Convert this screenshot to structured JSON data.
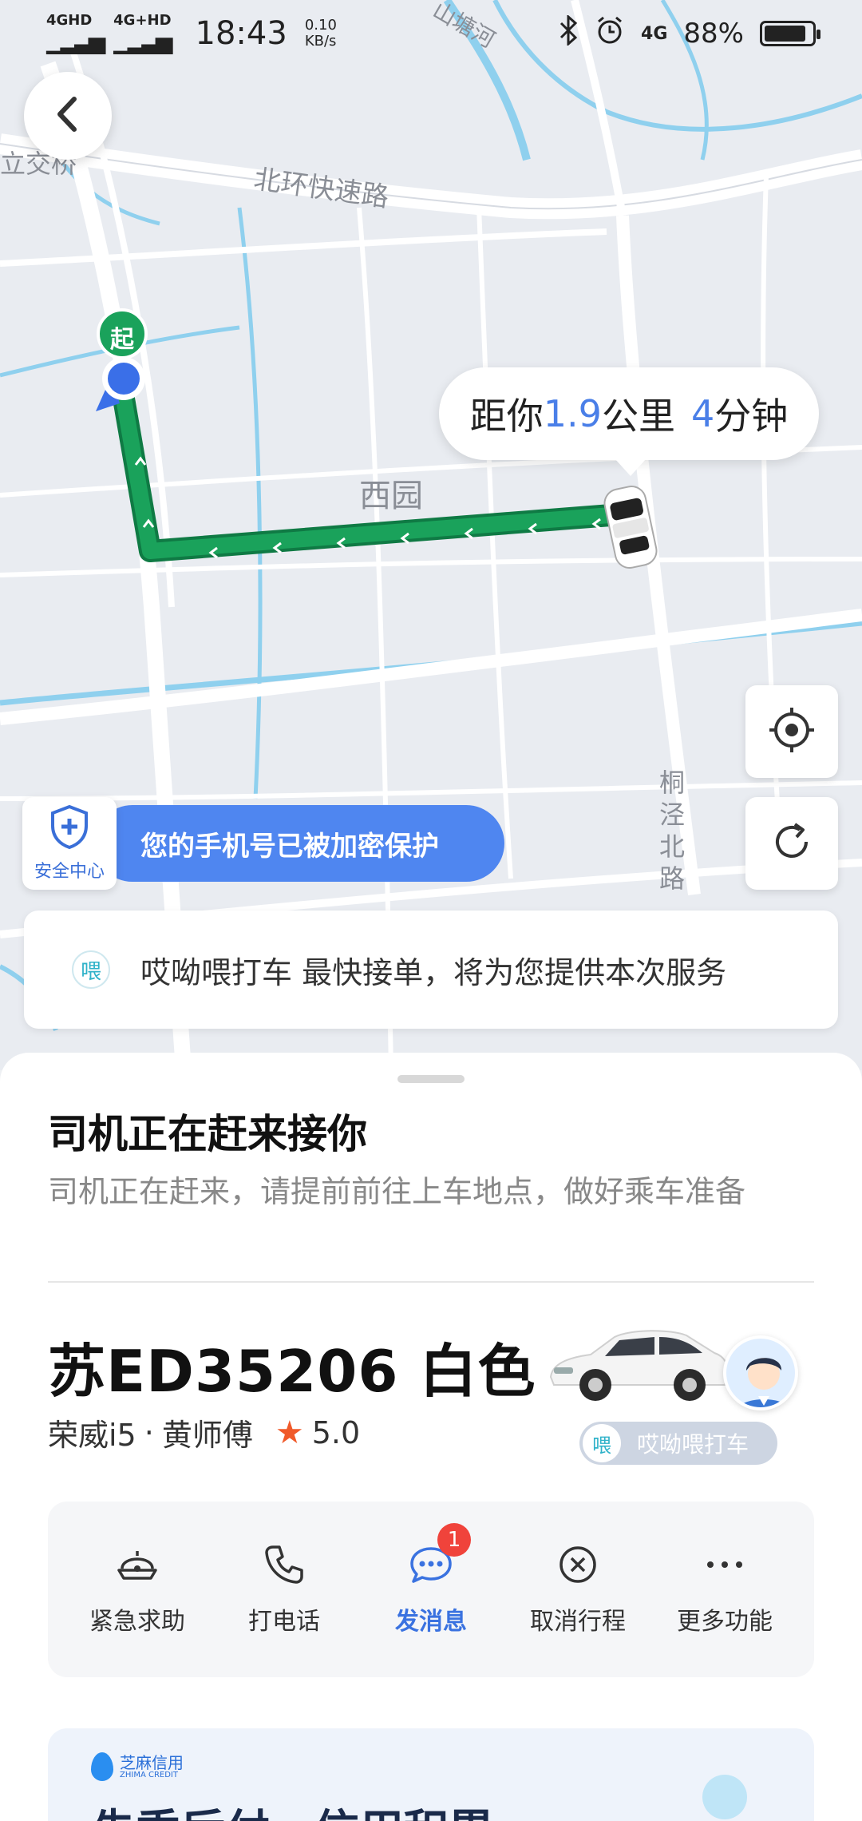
{
  "status_bar": {
    "sig1": "4GHD",
    "sig2": "4G+HD",
    "time": "18:43",
    "speed_top": "0.10",
    "speed_bottom": "KB/s",
    "net": "4G",
    "battery": "88%",
    "battery_level": 0.88
  },
  "map": {
    "road_label": "北环快速路",
    "area_label": "西园",
    "top_label": "立交桥",
    "canal_label": "山塘河",
    "road2_label": "桐泾北路",
    "start_marker": "起",
    "eta": {
      "prefix": "距你",
      "distance": "1.9",
      "distance_unit": "公里",
      "minutes": "4",
      "minutes_unit": "分钟"
    }
  },
  "safety": {
    "center_label": "安全中心",
    "privacy_text": "您的手机号已被加密保护"
  },
  "service": {
    "logo_char": "喂",
    "text": "哎呦喂打车 最快接单，将为您提供本次服务"
  },
  "sheet": {
    "title": "司机正在赶来接你",
    "subtitle": "司机正在赶来，请提前前往上车地点，做好乘车准备",
    "plate": "苏ED35206 白色",
    "car_model": "荣威i5",
    "dot": "·",
    "driver": "黄师傅",
    "rating": "5.0",
    "brand_tag": "哎呦喂打车",
    "brand_char": "喂"
  },
  "actions": [
    {
      "label": "紧急求助",
      "icon": "sos-icon"
    },
    {
      "label": "打电话",
      "icon": "phone-icon"
    },
    {
      "label": "发消息",
      "icon": "message-icon",
      "badge": "1"
    },
    {
      "label": "取消行程",
      "icon": "cancel-icon"
    },
    {
      "label": "更多功能",
      "icon": "more-icon"
    }
  ],
  "promo": {
    "logo_cn": "芝麻信用",
    "logo_en": "ZHIMA CREDIT",
    "title": "先乘后付，信用积累"
  },
  "colors": {
    "route": "#1aa25b",
    "accent": "#4f86f0",
    "badge": "#f0433b"
  }
}
